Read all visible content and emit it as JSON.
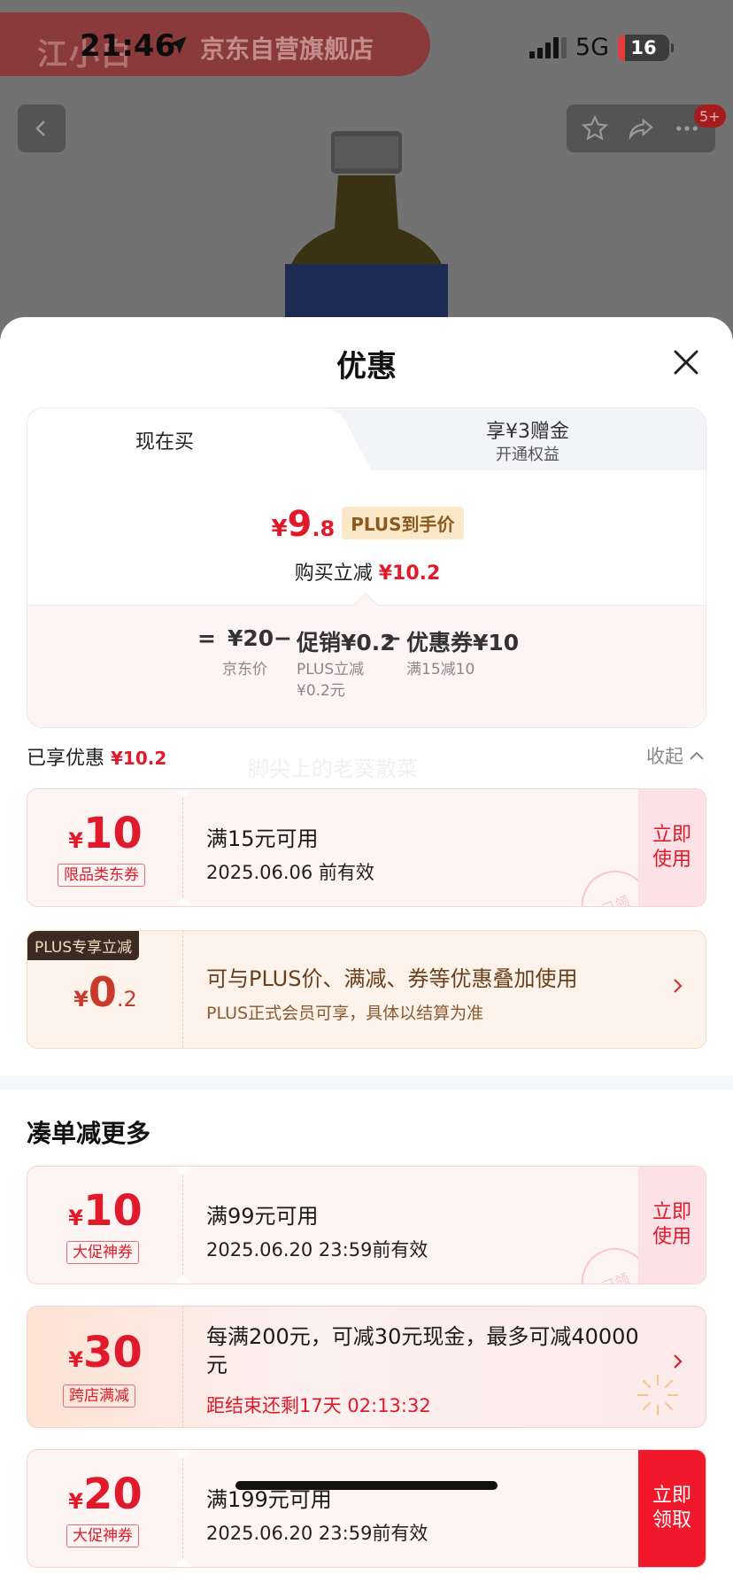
{
  "status_bar": {
    "time": "21:46",
    "network": "5G",
    "battery": "16"
  },
  "background": {
    "store_logo": "江小白",
    "store_name": "京东自营旗舰店",
    "cart_badge": "5+"
  },
  "sheet": {
    "title": "优惠",
    "tabs": [
      {
        "label": "现在买"
      },
      {
        "label": "享¥3赠金",
        "sub": "开通权益"
      }
    ],
    "summary": {
      "currency": "¥",
      "price_int": "9",
      "price_dec": ".8",
      "price_tag": "PLUS到手价",
      "reduce_label": "购买立减",
      "reduce_value": "¥10.2",
      "breakdown": {
        "eq": "=",
        "jd_price": "¥20",
        "jd_price_label": "京东价",
        "minus1": "−",
        "promo": "促销¥0.2",
        "promo_label_1": "PLUS立减",
        "promo_label_2": "¥0.2元",
        "minus2": "−",
        "coupon": "优惠券¥10",
        "coupon_label": "满15减10"
      }
    },
    "applied": {
      "label": "已享优惠",
      "value": "¥10.2",
      "collapse": "收起"
    },
    "watermark": "脚尖上的老葵散菜",
    "applied_coupons": [
      {
        "currency": "¥",
        "amount": "10",
        "tag": "限品类东券",
        "title": "满15元可用",
        "date": "2025.06.06 前有效",
        "action": "立即\n使用",
        "stamp": "已领"
      }
    ],
    "plus_card": {
      "badge": "PLUS专享立减",
      "currency": "¥",
      "amount_int": "0",
      "amount_dec": ".2",
      "title": "可与PLUS价、满减、券等优惠叠加使用",
      "sub": "PLUS正式会员可享，具体以结算为准"
    },
    "more_title": "凑单减更多",
    "more_coupons": [
      {
        "currency": "¥",
        "amount": "10",
        "tag": "大促神券",
        "title": "满99元可用",
        "date": "2025.06.20 23:59前有效",
        "action": "立即\n使用",
        "stamp": "已领"
      },
      {
        "currency": "¥",
        "amount": "20",
        "tag": "大促神券",
        "title": "满199元可用",
        "date": "2025.06.20 23:59前有效",
        "action": "立即\n领取"
      }
    ],
    "promo": {
      "currency": "¥",
      "amount": "30",
      "tag": "跨店满减",
      "title": "每满200元，可减30元现金，最多可减40000元",
      "countdown": "距结束还剩17天 02:13:32"
    }
  },
  "colors": {
    "accent_red": "#e01a2a",
    "plus_gold": "#fbe8c9"
  }
}
